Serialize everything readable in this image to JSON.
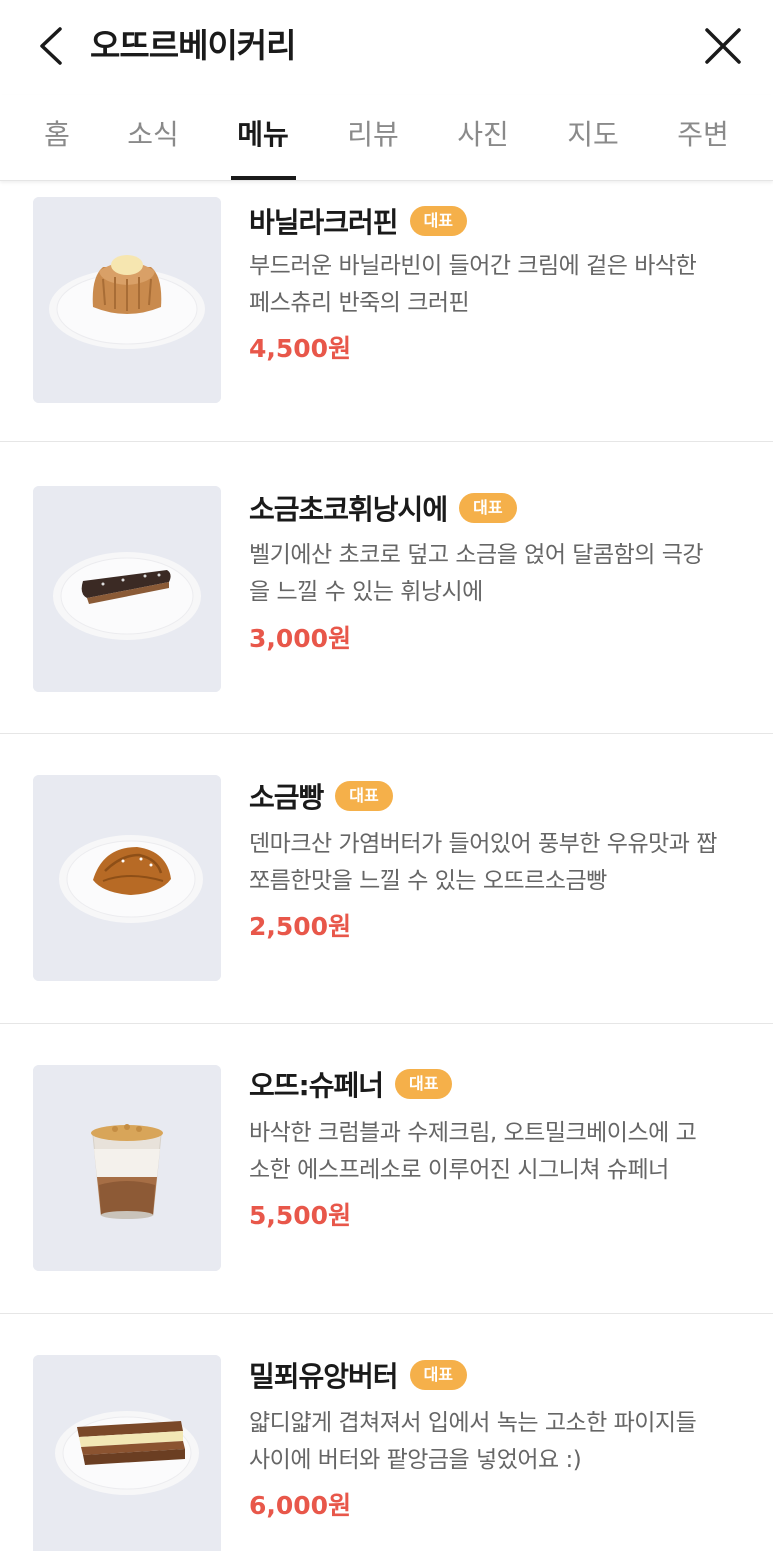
{
  "header": {
    "title": "오뜨르베이커리"
  },
  "tabs": [
    {
      "label": "홈"
    },
    {
      "label": "소식"
    },
    {
      "label": "메뉴"
    },
    {
      "label": "리뷰"
    },
    {
      "label": "사진"
    },
    {
      "label": "지도"
    },
    {
      "label": "주변"
    }
  ],
  "active_tab": "메뉴",
  "colors": {
    "badge": "#f5b04a",
    "price": "#e8574a"
  },
  "menu_items": [
    {
      "name": "바닐라크러핀",
      "badge": "대표",
      "desc_line1": "부드러운 바닐라빈이 들어간 크림에 겉은 바삭한",
      "desc_line2": "페스츄리 반죽의 크러핀",
      "price": "4,500원"
    },
    {
      "name": "소금초코휘낭시에",
      "badge": "대표",
      "desc_line1": "벨기에산 초코로 덮고 소금을 얹어 달콤함의 극강",
      "desc_line2": "을 느낄 수 있는 휘낭시에",
      "price": "3,000원"
    },
    {
      "name": "소금빵",
      "badge": "대표",
      "desc_line1": "덴마크산 가염버터가 들어있어 풍부한 우유맛과 짭",
      "desc_line2": "쪼름한맛을 느낄 수 있는 오뜨르소금빵",
      "price": "2,500원"
    },
    {
      "name": "오뜨:슈페너",
      "badge": "대표",
      "desc_line1": "바삭한 크럼블과 수제크림, 오트밀크베이스에 고",
      "desc_line2": "소한 에스프레소로 이루어진 시그니쳐 슈페너",
      "price": "5,500원"
    },
    {
      "name": "밀푀유앙버터",
      "badge": "대표",
      "desc_line1": "얇디얇게 겹쳐져서 입에서 녹는 고소한 파이지들",
      "desc_line2": "사이에 버터와 팥앙금을 넣었어요 :)",
      "price": "6,000원"
    }
  ]
}
